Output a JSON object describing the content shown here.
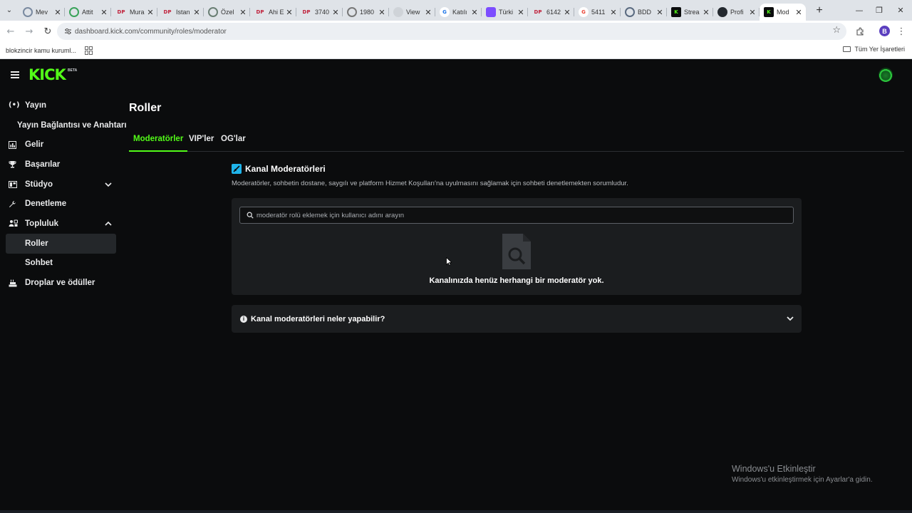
{
  "browser": {
    "tabs": [
      {
        "title": "Mev",
        "favicon": "circle-globe",
        "color": "#7a8aa0"
      },
      {
        "title": "Attit",
        "favicon": "circle-check",
        "color": "#3aa35a"
      },
      {
        "title": "Mura",
        "favicon": "dp-logo",
        "color": "#c0203a"
      },
      {
        "title": "Istan",
        "favicon": "dp-logo",
        "color": "#c0203a"
      },
      {
        "title": "Özel",
        "favicon": "circle-seal",
        "color": "#6a7f74"
      },
      {
        "title": "Ahi E",
        "favicon": "dp-logo",
        "color": "#c0203a"
      },
      {
        "title": "3740",
        "favicon": "dp-logo",
        "color": "#c0203a"
      },
      {
        "title": "1980",
        "favicon": "circle-gray",
        "color": "#777777"
      },
      {
        "title": "View",
        "favicon": "blank",
        "color": "#cfd3d8"
      },
      {
        "title": "Katılı",
        "favicon": "g-logo",
        "color": "#1a73e8"
      },
      {
        "title": "Türki",
        "favicon": "purple-app",
        "color": "#7c4dff"
      },
      {
        "title": "6142",
        "favicon": "dp-logo",
        "color": "#c0203a"
      },
      {
        "title": "5411",
        "favicon": "g-logo",
        "color": "#ea4335"
      },
      {
        "title": "BDD",
        "favicon": "circle-seal",
        "color": "#5a6a80"
      },
      {
        "title": "Strea",
        "favicon": "kick-logo",
        "color": "#53fc18"
      },
      {
        "title": "Profi",
        "favicon": "github-logo",
        "color": "#24292f"
      },
      {
        "title": "Mod",
        "favicon": "kick-logo",
        "color": "#53fc18",
        "active": true
      }
    ],
    "url": "dashboard.kick.com/community/roles/moderator",
    "bookmarks": {
      "item": "blokzincir kamu kuruml...",
      "all_bookmarks": "Tüm Yer İşaretleri"
    },
    "profile_initial": "B"
  },
  "app": {
    "logo": "KICK",
    "logo_badge": "BETA",
    "accent": "#53fc18"
  },
  "sidebar": {
    "items": [
      {
        "label": "Yayın",
        "icon": "broadcast-icon"
      },
      {
        "label": "Yayın Bağlantısı ve Anahtarı",
        "icon": ""
      },
      {
        "label": "Gelir",
        "icon": "revenue-icon"
      },
      {
        "label": "Başarılar",
        "icon": "trophy-icon"
      },
      {
        "label": "Stüdyo",
        "icon": "studio-icon"
      },
      {
        "label": "Denetleme",
        "icon": "wrench-icon"
      },
      {
        "label": "Topluluk",
        "icon": "community-icon"
      },
      {
        "label": "Roller",
        "icon": ""
      },
      {
        "label": "Sohbet",
        "icon": ""
      },
      {
        "label": "Droplar ve ödüller",
        "icon": "gift-icon"
      }
    ]
  },
  "main": {
    "title": "Roller",
    "tabs": [
      "Moderatörler",
      "VIP'ler",
      "OG'lar"
    ],
    "section": {
      "title": "Kanal Moderatörleri",
      "description": "Moderatörler, sohbetin dostane, saygılı ve platform Hizmet Koşulları'na uyulmasını sağlamak için sohbeti denetlemekten sorumludur.",
      "search_placeholder": "moderatör rolü eklemek için kullanıcı adını arayın",
      "empty_text": "Kanalınızda henüz herhangi bir moderatör yok."
    },
    "faq": {
      "title": "Kanal moderatörleri neler yapabilir?"
    }
  },
  "watermark": {
    "line1": "Windows'u Etkinleştir",
    "line2": "Windows'u etkinleştirmek için Ayarlar'a gidin."
  }
}
